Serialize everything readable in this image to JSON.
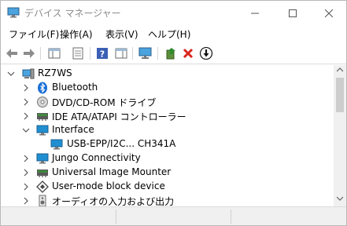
{
  "window": {
    "title": "デバイス マネージャー",
    "min_symbol": "–",
    "max_symbol": "□",
    "close_symbol": "✕"
  },
  "menu": [
    {
      "label": "ファイル(F)"
    },
    {
      "label": "操作(A)"
    },
    {
      "label": "表示(V)"
    },
    {
      "label": "ヘルプ(H)"
    }
  ],
  "toolbar": {
    "buttons": [
      {
        "icon": "back-arrow-icon"
      },
      {
        "icon": "forward-arrow-icon"
      },
      {
        "icon": "show-hide-console-tree-icon"
      },
      {
        "icon": "properties-icon"
      },
      {
        "icon": "help-icon"
      },
      {
        "icon": "action-pane-icon"
      },
      {
        "icon": "scan-hardware-icon"
      },
      {
        "icon": "update-driver-icon"
      },
      {
        "icon": "uninstall-device-icon"
      },
      {
        "icon": "disable-device-icon"
      }
    ],
    "accent_red": "#d9261c",
    "accent_blue": "#2b6bb3"
  },
  "tree": {
    "root": {
      "label": "RZ7WS",
      "expanded": true
    },
    "items": [
      {
        "label": "Bluetooth",
        "icon": "bluetooth-icon",
        "expanded": false
      },
      {
        "label": "DVD/CD-ROM ドライブ",
        "icon": "dvd-drive-icon",
        "expanded": false
      },
      {
        "label": "IDE ATA/ATAPI コントローラー",
        "icon": "ide-controller-icon",
        "expanded": false
      },
      {
        "label": "Interface",
        "icon": "monitor-icon",
        "expanded": true
      },
      {
        "label": "USB-EPP/I2C... CH341A",
        "icon": "monitor-icon",
        "child": true
      },
      {
        "label": "Jungo Connectivity",
        "icon": "monitor-icon",
        "expanded": false
      },
      {
        "label": "Universal Image Mounter",
        "icon": "storage-controller-icon",
        "expanded": false
      },
      {
        "label": "User-mode block device",
        "icon": "block-device-icon",
        "expanded": false
      },
      {
        "label": "オーディオの入力および出力",
        "icon": "audio-icon",
        "expanded": false
      }
    ]
  },
  "colors": {
    "bluetooth": "#1a6fd6",
    "monitor": "#1f8fd1"
  }
}
